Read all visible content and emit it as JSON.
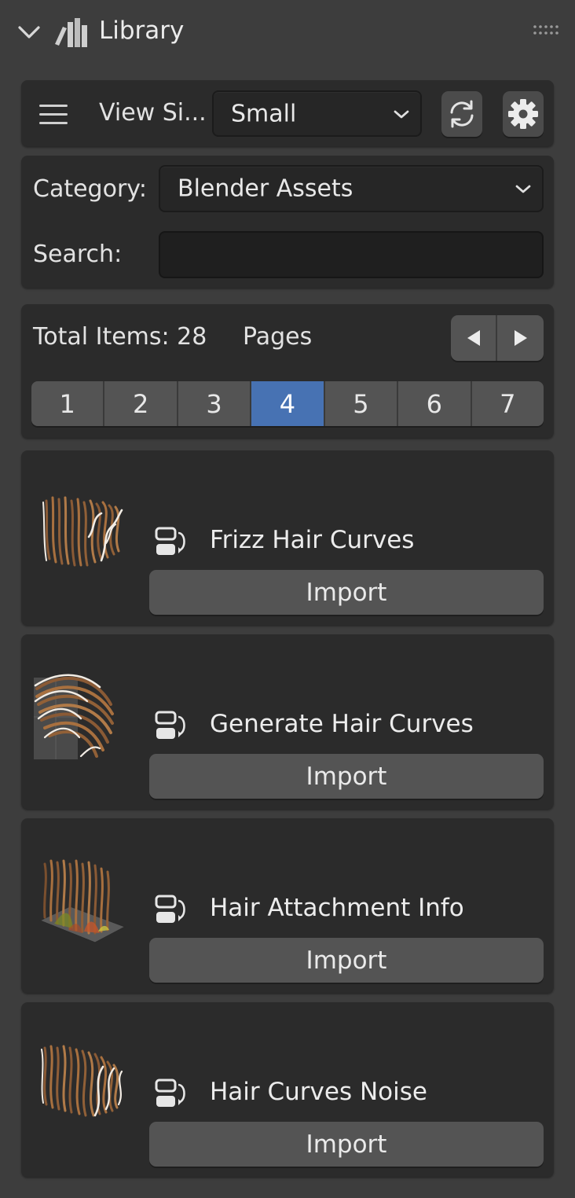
{
  "panel": {
    "title": "Library",
    "collapse_icon": "chevron-down-icon",
    "library_icon": "books-icon",
    "drag_icon": "grip-dots-icon"
  },
  "toolbar": {
    "menu_icon": "hamburger-menu-icon",
    "view_size_label": "View Si...",
    "view_size_value": "Small",
    "refresh_icon": "refresh-icon",
    "settings_icon": "gear-icon"
  },
  "filters": {
    "category_label": "Category:",
    "category_value": "Blender Assets",
    "search_label": "Search:",
    "search_value": ""
  },
  "pagination": {
    "total_label": "Total Items: 28",
    "pages_label": "Pages",
    "prev_icon": "triangle-left-icon",
    "next_icon": "triangle-right-icon",
    "pages": [
      "1",
      "2",
      "3",
      "4",
      "5",
      "6",
      "7"
    ],
    "active_page": "4"
  },
  "items": [
    {
      "name": "Frizz Hair Curves",
      "type_icon": "node-group-icon",
      "button": "Import"
    },
    {
      "name": "Generate Hair Curves",
      "type_icon": "node-group-icon",
      "button": "Import"
    },
    {
      "name": "Hair Attachment Info",
      "type_icon": "node-group-icon",
      "button": "Import"
    },
    {
      "name": "Hair Curves Noise",
      "type_icon": "node-group-icon",
      "button": "Import"
    }
  ],
  "colors": {
    "background": "#3d3d3d",
    "box": "#2b2b2b",
    "button": "#545454",
    "accent": "#4772b3"
  }
}
